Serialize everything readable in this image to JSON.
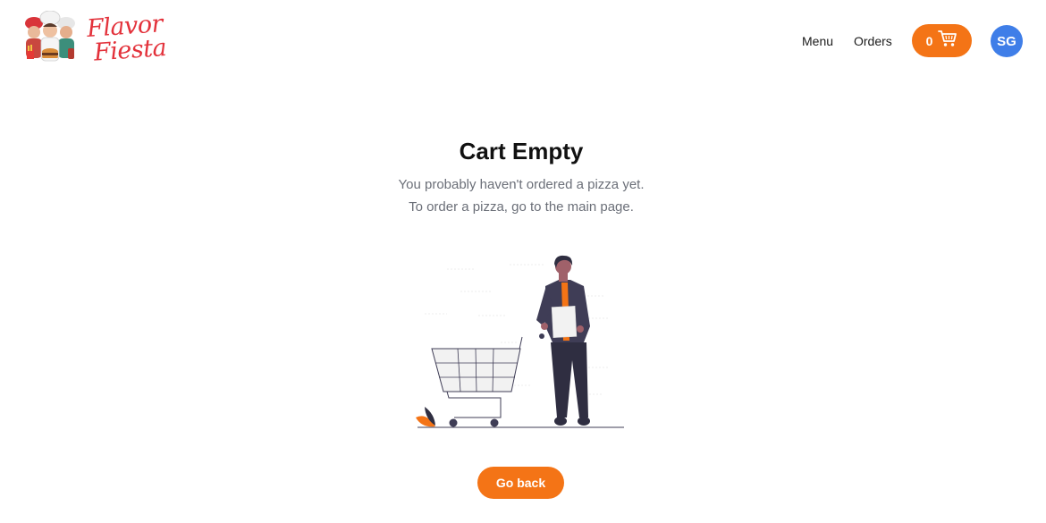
{
  "header": {
    "brand": {
      "line1": "Flavor",
      "line2": "Fiesta"
    },
    "nav": {
      "menu": "Menu",
      "orders": "Orders"
    },
    "cart": {
      "count": "0",
      "icon": "cart-icon"
    },
    "user": {
      "initials": "SG"
    }
  },
  "main": {
    "title": "Cart Empty",
    "subtitle_1": "You probably haven't ordered a pizza yet.",
    "subtitle_2": "To order a pizza, go to the main page.",
    "go_back_label": "Go back"
  },
  "colors": {
    "accent": "#f47416",
    "brand_text": "#e3323b",
    "avatar_bg": "#3f7ee8",
    "figure_dark": "#2f2e41"
  }
}
